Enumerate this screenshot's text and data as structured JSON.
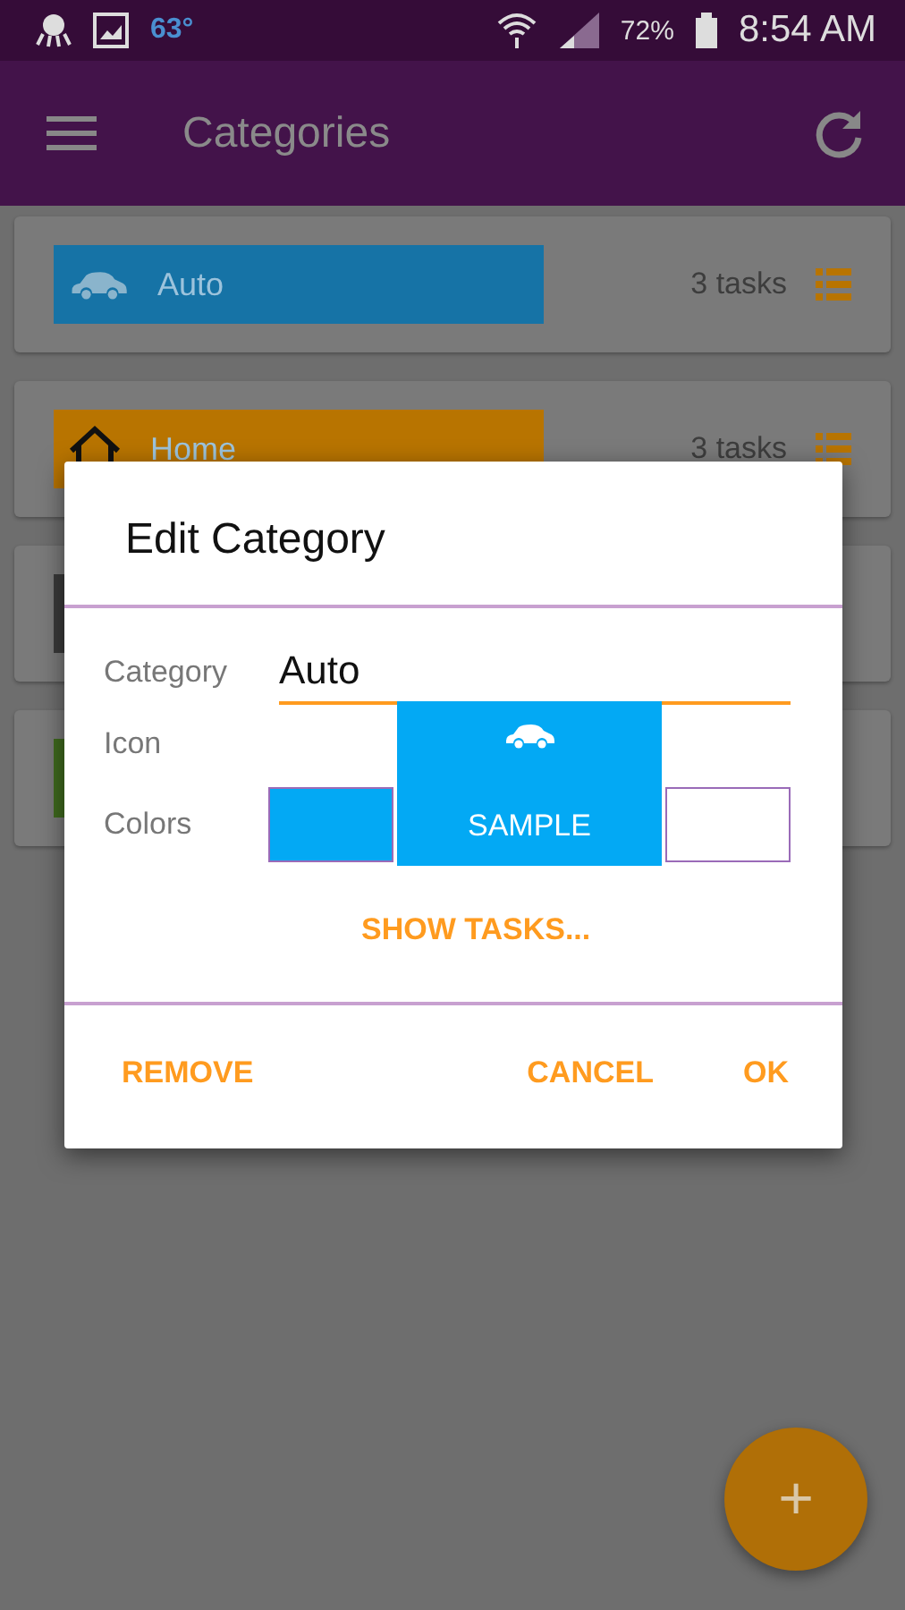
{
  "status_bar": {
    "temperature": "63°",
    "battery": "72%",
    "time": "8:54 AM"
  },
  "app_bar": {
    "title": "Categories"
  },
  "categories": [
    {
      "name": "Auto",
      "tasks": "3 tasks",
      "color": "#1673a6"
    },
    {
      "name": "Home",
      "tasks": "3 tasks",
      "color": "#b87400"
    },
    {
      "color": "#3a3a3a"
    },
    {
      "color": "#3f6a1e"
    }
  ],
  "dialog": {
    "title": "Edit Category",
    "category_label": "Category",
    "category_value": "Auto",
    "icon_label": "Icon",
    "colors_label": "Colors",
    "sample": "SAMPLE",
    "swatches": [
      {
        "color": "#03a9f4"
      },
      {
        "color": "#ffffff"
      }
    ],
    "link": "SHOW TASKS...",
    "buttons": [
      "REMOVE",
      "CANCEL",
      "OK"
    ]
  },
  "fab": "+"
}
